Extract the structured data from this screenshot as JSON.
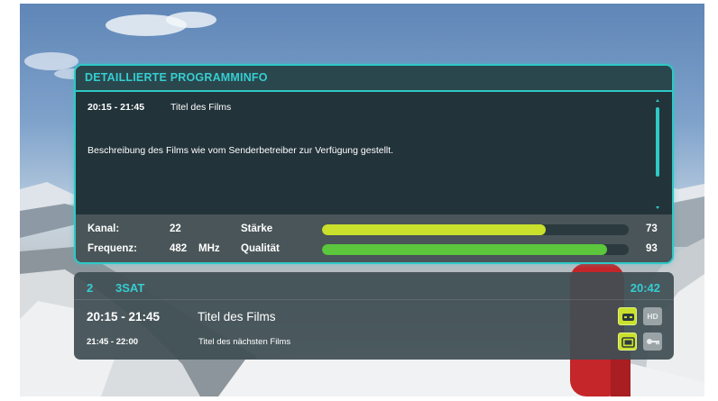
{
  "detail_panel": {
    "title": "DETAILLIERTE PROGRAMMINFO",
    "time": "20:15 - 21:45",
    "program_title": "Titel des Films",
    "description": "Beschreibung des Films wie vom Senderbetreiber zur Verfügung gestellt."
  },
  "signal": {
    "channel_label": "Kanal:",
    "channel_value": "22",
    "frequency_label": "Frequenz:",
    "frequency_value": "482",
    "frequency_unit": "MHz",
    "strength_label": "Stärke",
    "strength_value": "73",
    "strength_percent": 73,
    "quality_label": "Qualität",
    "quality_value": "93",
    "quality_percent": 93
  },
  "channel_bar": {
    "channel_number": "2",
    "channel_name": "3SAT",
    "clock": "20:42",
    "now_time": "20:15 - 21:45",
    "now_title": "Titel des Films",
    "next_time": "21:45 - 22:00",
    "next_title": "Titel des nächsten Films",
    "hd_badge": "HD"
  },
  "colors": {
    "accent": "#2ec8c6",
    "strength_bar": "#c9e02c",
    "quality_bar": "#5cc63c",
    "badge_active": "#c9e02c",
    "badge_inactive": "#9aa3a6"
  },
  "icons": {
    "subtitle": "subtitle-icon",
    "hd": "hd-icon",
    "teletext": "teletext-icon",
    "key": "key-icon"
  }
}
